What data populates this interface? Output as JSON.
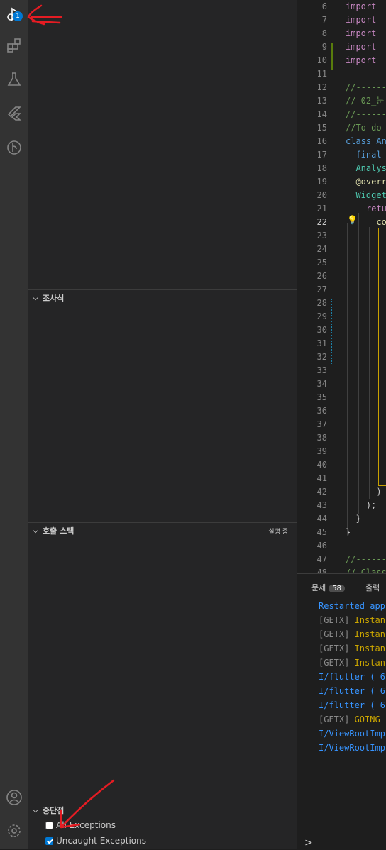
{
  "activity_bar": {
    "icons": [
      "run-debug-icon",
      "extensions-icon",
      "testing-icon",
      "flutter-icon",
      "source-control-icon",
      "account-icon",
      "settings-icon"
    ],
    "badge": "1"
  },
  "sidebar": {
    "watch_title": "조사식",
    "callstack_title": "호출 스택",
    "callstack_status": "실행 중",
    "breakpoints_title": "중단점",
    "breakpoints": [
      {
        "label": "All Exceptions",
        "checked": false
      },
      {
        "label": "Uncaught Exceptions",
        "checked": true
      }
    ]
  },
  "editor": {
    "lines": [
      {
        "n": "6",
        "t": "import"
      },
      {
        "n": "7",
        "t": "import"
      },
      {
        "n": "8",
        "t": "import"
      },
      {
        "n": "9",
        "t": "import"
      },
      {
        "n": "10",
        "t": "import"
      },
      {
        "n": "11",
        "t": ""
      },
      {
        "n": "12",
        "t": "//------"
      },
      {
        "n": "13",
        "t": "// 02_눈"
      },
      {
        "n": "14",
        "t": "//------"
      },
      {
        "n": "15",
        "t": "//To do"
      },
      {
        "n": "16",
        "t": "class An"
      },
      {
        "n": "17",
        "t": "  final"
      },
      {
        "n": "18",
        "t": "  Analys"
      },
      {
        "n": "19",
        "t": "  @overr"
      },
      {
        "n": "20",
        "t": "  Widget"
      },
      {
        "n": "21",
        "t": "    retu"
      },
      {
        "n": "22",
        "t": "      co"
      },
      {
        "n": "23",
        "t": ""
      },
      {
        "n": "24",
        "t": ""
      },
      {
        "n": "25",
        "t": ""
      },
      {
        "n": "26",
        "t": ""
      },
      {
        "n": "27",
        "t": ""
      },
      {
        "n": "28",
        "t": ""
      },
      {
        "n": "29",
        "t": ""
      },
      {
        "n": "30",
        "t": ""
      },
      {
        "n": "31",
        "t": ""
      },
      {
        "n": "32",
        "t": ""
      },
      {
        "n": "33",
        "t": ""
      },
      {
        "n": "34",
        "t": ""
      },
      {
        "n": "35",
        "t": ""
      },
      {
        "n": "36",
        "t": ""
      },
      {
        "n": "37",
        "t": ""
      },
      {
        "n": "38",
        "t": ""
      },
      {
        "n": "39",
        "t": ""
      },
      {
        "n": "40",
        "t": ""
      },
      {
        "n": "41",
        "t": ""
      },
      {
        "n": "42",
        "t": "      )"
      },
      {
        "n": "43",
        "t": "    );"
      },
      {
        "n": "44",
        "t": "  }"
      },
      {
        "n": "45",
        "t": "}"
      },
      {
        "n": "46",
        "t": ""
      },
      {
        "n": "47",
        "t": "//------"
      },
      {
        "n": "48",
        "t": "// Class"
      }
    ],
    "current_line": "22"
  },
  "panel": {
    "tab_problems": "문제",
    "problems_count": "58",
    "tab_output": "출력",
    "output": [
      {
        "text": "Restarted app",
        "kind": "blue"
      },
      {
        "prefix": "[GETX]",
        "text": " Instan",
        "kind": "getx"
      },
      {
        "prefix": "[GETX]",
        "text": " Instan",
        "kind": "getx"
      },
      {
        "prefix": "[GETX]",
        "text": " Instan",
        "kind": "getx"
      },
      {
        "prefix": "[GETX]",
        "text": " Instan",
        "kind": "getx"
      },
      {
        "text": "I/flutter ( 6",
        "kind": "blue"
      },
      {
        "text": "I/flutter ( 6",
        "kind": "blue"
      },
      {
        "text": "I/flutter ( 6",
        "kind": "blue"
      },
      {
        "prefix": "[GETX]",
        "text": " GOING",
        "kind": "getx"
      },
      {
        "text": "I/ViewRootImp",
        "kind": "blue"
      },
      {
        "text": "I/ViewRootImp",
        "kind": "blue"
      }
    ],
    "prompt": ">"
  },
  "colors": {
    "accent": "#0078d4",
    "annotation_red": "#e51c23"
  }
}
